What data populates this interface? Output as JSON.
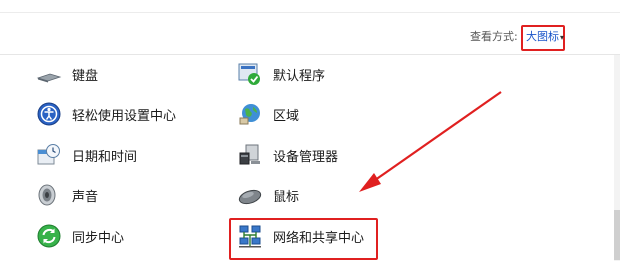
{
  "toolbar": {
    "view_by_label": "查看方式:",
    "view_by_value": "大图标",
    "view_by_caret": "▾"
  },
  "items": [
    {
      "label": "键盘",
      "icon": "keyboard-icon"
    },
    {
      "label": "默认程序",
      "icon": "default-programs-icon"
    },
    {
      "label": "轻松使用设置中心",
      "icon": "ease-of-access-icon"
    },
    {
      "label": "区域",
      "icon": "region-icon"
    },
    {
      "label": "日期和时间",
      "icon": "date-time-icon"
    },
    {
      "label": "设备管理器",
      "icon": "device-manager-icon"
    },
    {
      "label": "声音",
      "icon": "sound-icon"
    },
    {
      "label": "鼠标",
      "icon": "mouse-icon"
    },
    {
      "label": "同步中心",
      "icon": "sync-center-icon"
    },
    {
      "label": "网络和共享中心",
      "icon": "network-sharing-icon"
    }
  ],
  "colors": {
    "annotation_red": "#e02020",
    "link_blue": "#1a55c9"
  }
}
